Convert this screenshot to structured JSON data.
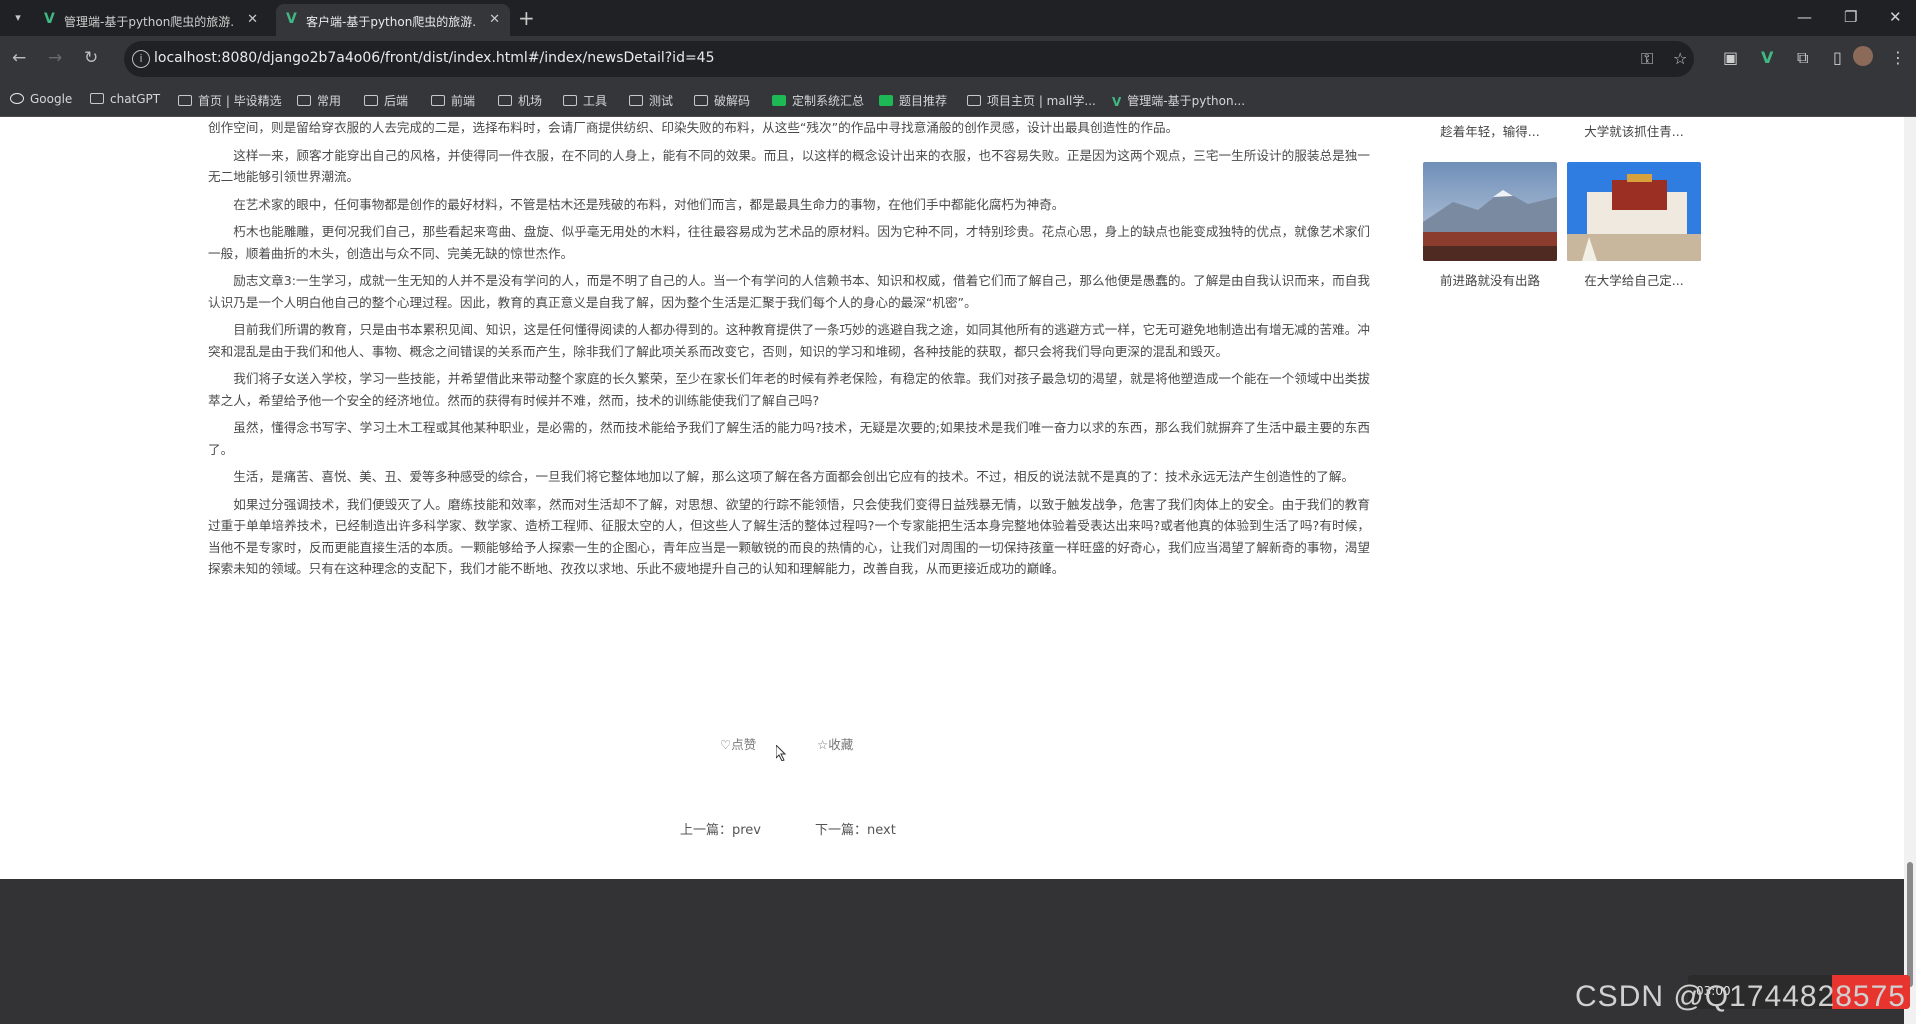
{
  "tabs": [
    {
      "title": "管理端-基于python爬虫的旅游..."
    },
    {
      "title": "客户端-基于python爬虫的旅游..."
    }
  ],
  "address_bar": {
    "url": "localhost:8080/django2b7a4o06/front/dist/index.html#/index/newsDetail?id=45"
  },
  "bookmarks": [
    {
      "label": "Google",
      "icon": "google-icon"
    },
    {
      "label": "chatGPT",
      "icon": "bookmark-icon"
    },
    {
      "label": "首页 | 毕设精选",
      "icon": "bookmark-icon"
    },
    {
      "label": "常用",
      "icon": "folder-icon"
    },
    {
      "label": "后端",
      "icon": "folder-icon"
    },
    {
      "label": "前端",
      "icon": "folder-icon"
    },
    {
      "label": "机场",
      "icon": "folder-icon"
    },
    {
      "label": "工具",
      "icon": "folder-icon"
    },
    {
      "label": "测试",
      "icon": "folder-icon"
    },
    {
      "label": "破解码",
      "icon": "folder-icon"
    },
    {
      "label": "定制系统汇总",
      "icon": "sheet-icon"
    },
    {
      "label": "题目推荐",
      "icon": "sheet-icon"
    },
    {
      "label": "项目主页 | mall学...",
      "icon": "page-icon"
    },
    {
      "label": "管理端-基于python...",
      "icon": "vue-icon"
    }
  ],
  "article": {
    "paragraphs": [
      "创作空间，则是留给穿衣服的人去完成的二是，选择布料时，会请厂商提供纺织、印染失败的布料，从这些“残次”的作品中寻找意涌般的创作灵感，设计出最具创造性的作品。",
      "这样一来，顾客才能穿出自己的风格，并使得同一件衣服，在不同的人身上，能有不同的效果。而且，以这样的概念设计出来的衣服，也不容易失败。正是因为这两个观点，三宅一生所设计的服装总是独一无二地能够引领世界潮流。",
      "在艺术家的眼中，任何事物都是创作的最好材料，不管是枯木还是残破的布料，对他们而言，都是最具生命力的事物，在他们手中都能化腐朽为神奇。",
      "朽木也能雕雕，更何况我们自己，那些看起来弯曲、盘旋、似乎毫无用处的木料，往往最容易成为艺术品的原材料。因为它种不同，才特别珍贵。花点心思，身上的缺点也能变成独特的优点，就像艺术家们一般，顺着曲折的木头，创造出与众不同、完美无缺的惊世杰作。",
      "励志文章3:一生学习，成就一生无知的人并不是没有学问的人，而是不明了自己的人。当一个有学问的人信赖书本、知识和权威，借着它们而了解自己，那么他便是愚蠢的。了解是由自我认识而来，而自我认识乃是一个人明白他自己的整个心理过程。因此，教育的真正意义是自我了解，因为整个生活是汇聚于我们每个人的身心的最深“机密”。",
      "目前我们所谓的教育，只是由书本累积见闻、知识，这是任何懂得阅读的人都办得到的。这种教育提供了一条巧妙的逃避自我之途，如同其他所有的逃避方式一样，它无可避免地制造出有增无减的苦难。冲突和混乱是由于我们和他人、事物、概念之间错误的关系而产生，除非我们了解此项关系而改变它，否则，知识的学习和堆砌，各种技能的获取，都只会将我们导向更深的混乱和毁灭。",
      "我们将子女送入学校，学习一些技能，并希望借此来带动整个家庭的长久繁荣，至少在家长们年老的时候有养老保险，有稳定的依靠。我们对孩子最急切的渴望，就是将他塑造成一个能在一个领域中出类拔萃之人，希望给予他一个安全的经济地位。然而的获得有时候并不难，然而，技术的训练能使我们了解自己吗?",
      "虽然，懂得念书写字、学习土木工程或其他某种职业，是必需的，然而技术能给予我们了解生活的能力吗?技术，无疑是次要的;如果技术是我们唯一奋力以求的东西，那么我们就摒弃了生活中最主要的东西了。",
      "生活，是痛苦、喜悦、美、丑、爱等多种感受的综合，一旦我们将它整体地加以了解，那么这项了解在各方面都会创出它应有的技术。不过，相反的说法就不是真的了：技术永远无法产生创造性的了解。",
      "如果过分强调技术，我们便毁灭了人。磨练技能和效率，然而对生活却不了解，对思想、欲望的行踪不能领悟，只会使我们变得日益残暴无情，以致于触发战争，危害了我们肉体上的安全。由于我们的教育过重于单单培养技术，已经制造出许多科学家、数学家、造桥工程师、征服太空的人，但这些人了解生活的整体过程吗?一个专家能把生活本身完整地体验着受表达出来吗?或者他真的体验到生活了吗?有时候，当他不是专家时，反而更能直接生活的本质。一颗能够给予人探索一生的企图心，青年应当是一颗敏锐的而良的热情的心，让我们对周围的一切保持孩童一样旺盛的好奇心，我们应当渴望了解新奇的事物，渴望探索未知的领域。只有在这种理念的支配下，我们才能不断地、孜孜以求地、乐此不疲地提升自己的认知和理解能力，改善自我，从而更接近成功的巅峰。"
    ],
    "like_label": "点赞",
    "collect_label": "收藏",
    "prev_label": "上一篇：prev",
    "next_label": "下一篇：next"
  },
  "sidebar": {
    "items": [
      {
        "caption": "趁着年轻，输得..."
      },
      {
        "caption": "大学就该抓住青..."
      },
      {
        "caption": "前进路就没有出路"
      },
      {
        "caption": "在大学给自己定..."
      }
    ]
  },
  "watermark": "CSDN @Q1744828575",
  "recording": {
    "time": "03:00"
  }
}
